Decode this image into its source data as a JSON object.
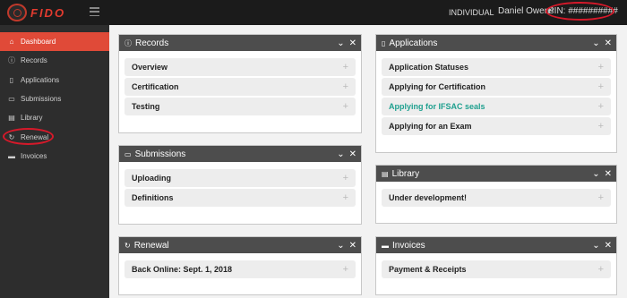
{
  "app": {
    "logo_text": "FIDO"
  },
  "topbar": {
    "role": "INDIVIDUAL",
    "user_name": "Daniel Owens",
    "pin": "PIN: ##########",
    "accent_color": "#d6192a"
  },
  "sidebar": {
    "items": [
      {
        "label": "Dashboard",
        "icon": "home-icon",
        "active": true
      },
      {
        "label": "Records",
        "icon": "info-icon"
      },
      {
        "label": "Applications",
        "icon": "file-icon"
      },
      {
        "label": "Submissions",
        "icon": "inbox-icon"
      },
      {
        "label": "Library",
        "icon": "book-icon"
      },
      {
        "label": "Renewal",
        "icon": "refresh-icon"
      },
      {
        "label": "Invoices",
        "icon": "card-icon"
      }
    ]
  },
  "panels": {
    "records": {
      "title": "Records",
      "icon": "info-icon",
      "rows": [
        "Overview",
        "Certification",
        "Testing"
      ]
    },
    "submissions": {
      "title": "Submissions",
      "icon": "inbox-icon",
      "rows": [
        "Uploading",
        "Definitions"
      ]
    },
    "renewal": {
      "title": "Renewal",
      "icon": "refresh-icon",
      "rows": [
        "Back Online: Sept. 1, 2018"
      ]
    },
    "applications": {
      "title": "Applications",
      "icon": "file-icon",
      "rows": [
        "Application Statuses",
        "Applying for Certification",
        "Applying for IFSAC seals",
        "Applying for an Exam"
      ]
    },
    "library": {
      "title": "Library",
      "icon": "book-icon",
      "rows": [
        "Under development!"
      ]
    },
    "invoices": {
      "title": "Invoices",
      "icon": "card-icon",
      "rows": [
        "Payment & Receipts"
      ]
    }
  },
  "colors": {
    "sidebar_active": "#e04a38",
    "link_row": "#1fa08f",
    "panel_header": "#4d4d4d"
  }
}
